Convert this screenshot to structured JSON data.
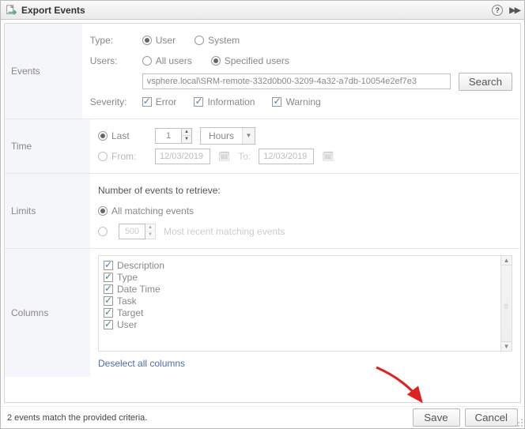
{
  "window": {
    "title": "Export Events"
  },
  "sections": {
    "events": "Events",
    "time": "Time",
    "limits": "Limits",
    "columns": "Columns"
  },
  "events": {
    "typeLabel": "Type:",
    "typeUser": "User",
    "typeSystem": "System",
    "usersLabel": "Users:",
    "usersAll": "All users",
    "usersSpecified": "Specified users",
    "userValue": "vsphere.local\\SRM-remote-332d0b00-3209-4a32-a7db-10054e2ef7e3",
    "searchBtn": "Search",
    "severityLabel": "Severity:",
    "sevError": "Error",
    "sevInformation": "Information",
    "sevWarning": "Warning"
  },
  "time": {
    "lastLabel": "Last",
    "lastValue": "1",
    "unit": "Hours",
    "fromLabel": "From:",
    "fromDate": "12/03/2019",
    "toLabel": "To:",
    "toDate": "12/03/2019"
  },
  "limits": {
    "header": "Number of events to retrieve:",
    "allLabel": "All matching events",
    "recentValue": "500",
    "recentLabel": "Most recent matching events"
  },
  "columns": {
    "items": [
      {
        "label": "Description"
      },
      {
        "label": "Type"
      },
      {
        "label": "Date Time"
      },
      {
        "label": "Task"
      },
      {
        "label": "Target"
      },
      {
        "label": "User"
      }
    ],
    "deselect": "Deselect all columns"
  },
  "footer": {
    "status": "2 events match the provided criteria.",
    "save": "Save",
    "cancel": "Cancel"
  }
}
